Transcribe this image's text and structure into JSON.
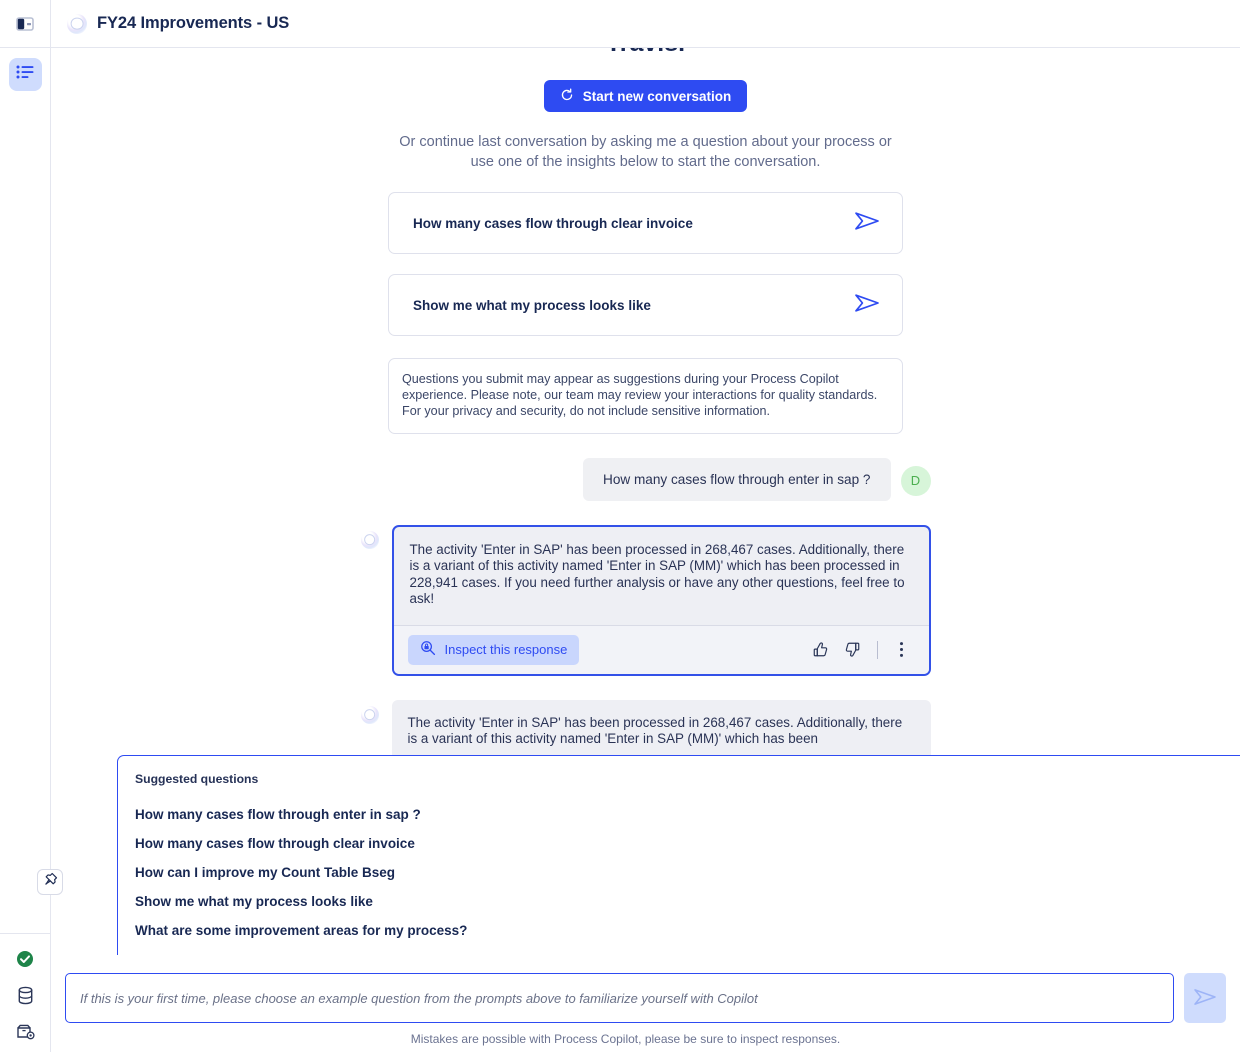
{
  "window": {
    "title": "FY24 Improvements - US"
  },
  "rail": {
    "toggle_name": "panel-toggle-icon",
    "items": [
      {
        "name": "insights",
        "icon": "list-icon",
        "active": true
      }
    ],
    "pin_label": "pin-icon",
    "status_items": [
      {
        "name": "connection-ok",
        "icon": "check-circle-icon"
      },
      {
        "name": "data-source",
        "icon": "database-icon"
      },
      {
        "name": "settings-box",
        "icon": "box-settings-icon"
      }
    ]
  },
  "hero": {
    "title": "Travis.",
    "start_button": "Start new conversation",
    "subtitle": "Or continue last conversation by asking me a question about your process or use one of the insights below to start the conversation.",
    "insight_cards": [
      "How many cases flow through clear invoice",
      "Show me what my process looks like"
    ],
    "notice": "Questions you submit may appear as suggestions during your Process Copilot experience. Please note, our team may review your interactions for quality standards. For your privacy and security, do not include sensitive information."
  },
  "conversation": [
    {
      "role": "user",
      "text": "How many cases flow through enter in sap ?",
      "avatar_initial": "D"
    },
    {
      "role": "assistant",
      "focused": true,
      "text": "The activity 'Enter in SAP' has been processed in 268,467 cases. Additionally, there is a variant of this activity named 'Enter in SAP (MM)' which has been processed in 228,941 cases. If you need further analysis or have any other questions, feel free to ask!",
      "inspect_label": "Inspect this response"
    },
    {
      "role": "assistant",
      "focused": false,
      "text": "The activity 'Enter in SAP' has been processed in 268,467 cases. Additionally, there is a variant of this activity named 'Enter in SAP (MM)' which has been"
    }
  ],
  "suggestions": {
    "heading": "Suggested questions",
    "items": [
      "How many cases flow through enter in sap ?",
      "How many cases flow through clear invoice",
      "How can I improve my Count Table Bseg",
      "Show me what my process looks like",
      "What are some improvement areas for my process?"
    ]
  },
  "composer": {
    "value": "",
    "placeholder": "If this is your first time, please choose an example question from the prompts above to familiarize yourself with Copilot",
    "send_label": "send-icon"
  },
  "footer": {
    "note": "Mistakes are possible with Process Copilot, please be sure to inspect responses."
  },
  "colors": {
    "accent": "#2e4bf2",
    "accent_soft": "#cfdcfd",
    "text": "#182853",
    "muted": "#626b8c",
    "bot_bg": "#eeeff4",
    "user_bg": "#eff0f3",
    "avatar_green_bg": "#d7f5d9",
    "avatar_green_fg": "#4caf50"
  }
}
